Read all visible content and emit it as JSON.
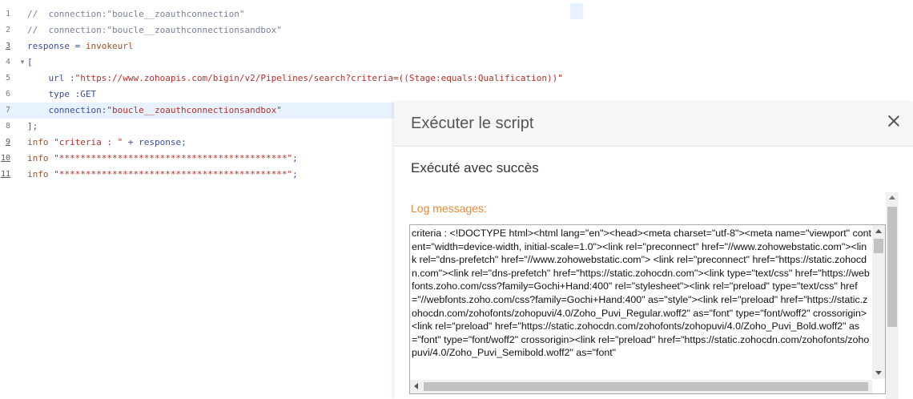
{
  "editor": {
    "lines": [
      {
        "num": "1",
        "parts": [
          {
            "t": "//  connection:\"boucle__zoauthconnection\"",
            "c": "comment"
          }
        ]
      },
      {
        "num": "2",
        "parts": [
          {
            "t": "//  connection:\"boucle__zoauthconnectionsandbox\"",
            "c": "comment"
          }
        ]
      },
      {
        "num": "3",
        "parts": [
          {
            "t": "response",
            "c": "var"
          },
          {
            "t": " = ",
            "c": "var"
          },
          {
            "t": "invokeurl",
            "c": "kw"
          }
        ]
      },
      {
        "num": "4",
        "parts": [
          {
            "t": "[",
            "c": "var"
          }
        ]
      },
      {
        "num": "5",
        "parts": [
          {
            "t": "    url :",
            "c": "var"
          },
          {
            "t": "\"https://www.zohoapis.com/bigin/v2/Pipelines/search?criteria=((Stage:equals:Qualification))\"",
            "c": "str"
          }
        ]
      },
      {
        "num": "6",
        "parts": [
          {
            "t": "    type :GET",
            "c": "var"
          }
        ]
      },
      {
        "num": "7",
        "parts": [
          {
            "t": "    connection:",
            "c": "var"
          },
          {
            "t": "\"boucle__zoauthconnectionsandbox\"",
            "c": "str"
          }
        ]
      },
      {
        "num": "8",
        "parts": [
          {
            "t": "];",
            "c": "var"
          }
        ]
      },
      {
        "num": "9",
        "parts": [
          {
            "t": "info ",
            "c": "kw"
          },
          {
            "t": "\"criteria : \"",
            "c": "str"
          },
          {
            "t": " + response;",
            "c": "var"
          }
        ]
      },
      {
        "num": "10",
        "parts": [
          {
            "t": "info ",
            "c": "kw"
          },
          {
            "t": "\"*******************************************\"",
            "c": "str"
          },
          {
            "t": ";",
            "c": "var"
          }
        ]
      },
      {
        "num": "11",
        "parts": [
          {
            "t": "info ",
            "c": "kw"
          },
          {
            "t": "\"*******************************************\"",
            "c": "str"
          },
          {
            "t": ";",
            "c": "var"
          }
        ]
      }
    ]
  },
  "dialog": {
    "title": "Exécuter le script",
    "status": "Exécuté avec succès",
    "log_label": "Log messages:",
    "log_text": "criteria : <!DOCTYPE html><html lang=\"en\"><head><meta charset=\"utf-8\"><meta name=\"viewport\" content=\"width=device-width, initial-scale=1.0\"><link rel=\"preconnect\" href=\"//www.zohowebstatic.com\"><link rel=\"dns-prefetch\" href=\"//www.zohowebstatic.com\"> <link rel=\"preconnect\" href=\"https://static.zohocdn.com\"><link rel=\"dns-prefetch\" href=\"https://static.zohocdn.com\"><link type=\"text/css\" href=\"https://webfonts.zoho.com/css?family=Gochi+Hand:400\" rel=\"stylesheet\"><link rel=\"preload\" type=\"text/css\" href=\"//webfonts.zoho.com/css?family=Gochi+Hand:400\" as=\"style\"><link rel=\"preload\" href=\"https://static.zohocdn.com/zohofonts/zohopuvi/4.0/Zoho_Puvi_Regular.woff2\" as=\"font\" type=\"font/woff2\" crossorigin><link rel=\"preload\" href=\"https://static.zohocdn.com/zohofonts/zohopuvi/4.0/Zoho_Puvi_Bold.woff2\" as=\"font\" type=\"font/woff2\" crossorigin><link rel=\"preload\" href=\"https://static.zohocdn.com/zohofonts/zohopuvi/4.0/Zoho_Puvi_Semibold.woff2\" as=\"font\""
  }
}
